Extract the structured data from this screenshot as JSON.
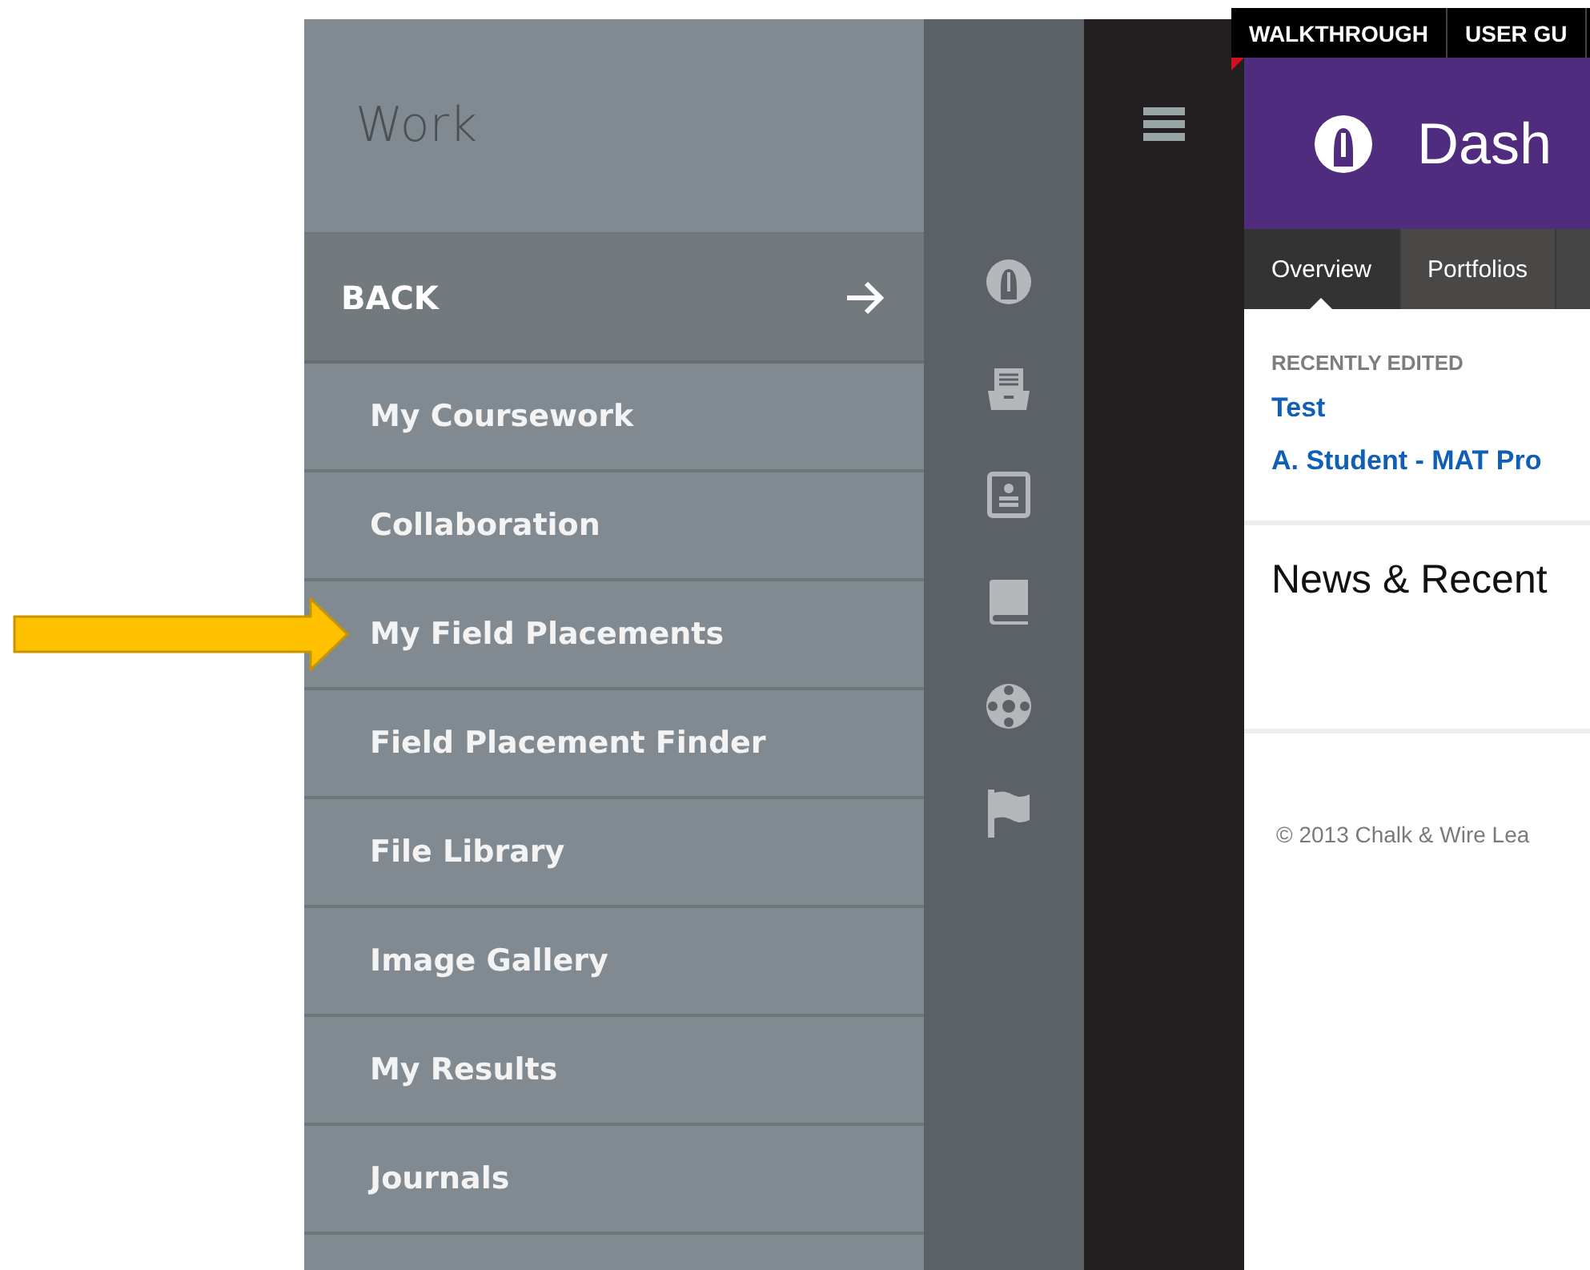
{
  "sidebar": {
    "title": "Work",
    "back": "BACK",
    "items": [
      {
        "label": "My Coursework"
      },
      {
        "label": "Collaboration"
      },
      {
        "label": "My Field Placements"
      },
      {
        "label": "Field Placement Finder"
      },
      {
        "label": "File Library"
      },
      {
        "label": "Image Gallery"
      },
      {
        "label": "My Results"
      },
      {
        "label": "Journals"
      }
    ]
  },
  "main": {
    "top_links": [
      "WALKTHROUGH",
      "USER GU"
    ],
    "header_title": "Dash",
    "tabs": [
      {
        "label": "Overview",
        "selected": true
      },
      {
        "label": "Portfolios",
        "selected": false
      }
    ],
    "recent": {
      "heading": "RECENTLY EDITED",
      "items": [
        "Test",
        "A. Student - MAT Pro"
      ]
    },
    "news_heading": "News & Recent",
    "footer": "© 2013 Chalk & Wire Lea"
  }
}
